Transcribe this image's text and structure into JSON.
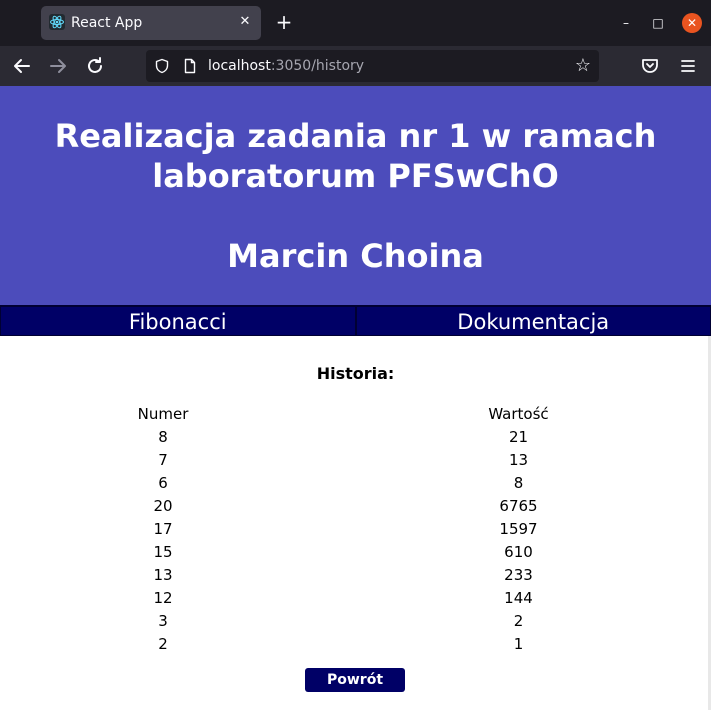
{
  "browser": {
    "tab_title": "React App",
    "tab_close_icon": "close-icon",
    "new_tab_symbol": "+",
    "url_host": "localhost",
    "url_rest": ":3050/history",
    "window_minimize": "–",
    "window_maximize": "□",
    "window_close": "✕"
  },
  "header": {
    "title_line1": "Realizacja zadania nr 1 w ramach",
    "title_line2": "laboratorum PFSwChO",
    "author": "Marcin Choina",
    "background_color": "#4c4cbb"
  },
  "menu": {
    "items": [
      {
        "label": "Fibonacci"
      },
      {
        "label": "Dokumentacja"
      }
    ],
    "background_color": "#000066"
  },
  "history": {
    "title": "Historia:",
    "columns": [
      "Numer",
      "Wartość"
    ],
    "rows": [
      {
        "number": "8",
        "value": "21"
      },
      {
        "number": "7",
        "value": "13"
      },
      {
        "number": "6",
        "value": "8"
      },
      {
        "number": "20",
        "value": "6765"
      },
      {
        "number": "17",
        "value": "1597"
      },
      {
        "number": "15",
        "value": "610"
      },
      {
        "number": "13",
        "value": "233"
      },
      {
        "number": "12",
        "value": "144"
      },
      {
        "number": "3",
        "value": "2"
      },
      {
        "number": "2",
        "value": "1"
      }
    ]
  },
  "actions": {
    "back_label": "Powrót"
  }
}
